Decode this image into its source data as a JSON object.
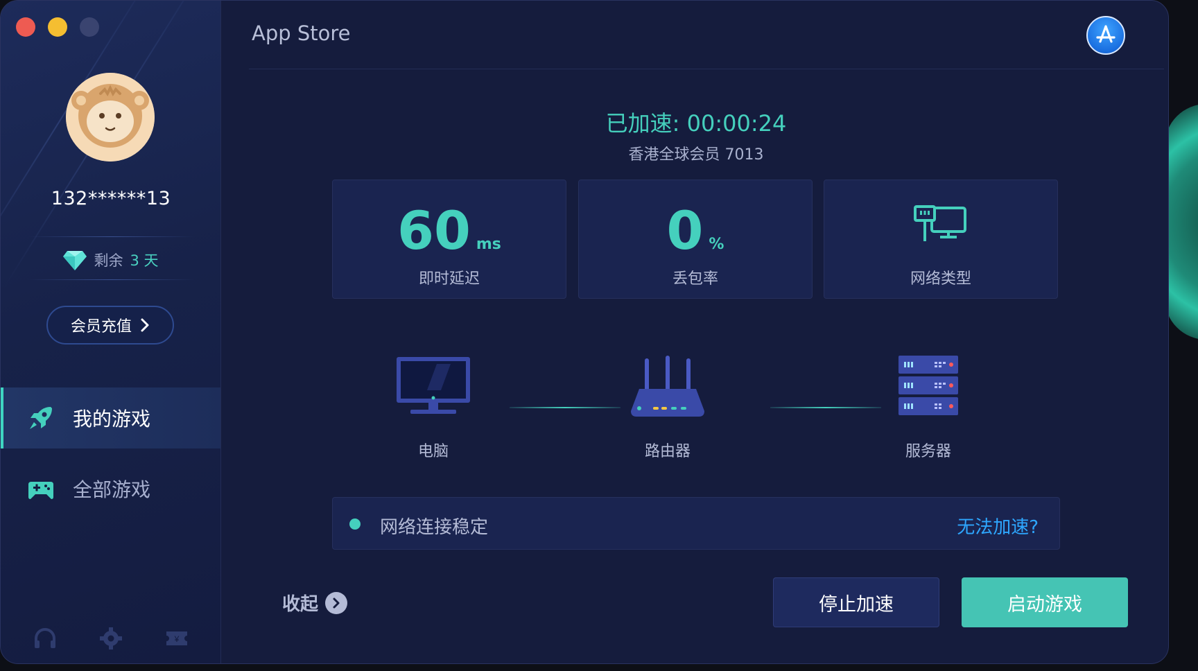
{
  "window": {
    "title": "App Store",
    "app_icon": "app-store-icon"
  },
  "sidebar": {
    "username": "132******13",
    "membership": {
      "remaining_label": "剩余",
      "remaining_value": "3 天",
      "icon": "diamond-icon"
    },
    "recharge_label": "会员充值",
    "nav": [
      {
        "label": "我的游戏",
        "icon": "rocket-icon",
        "active": true
      },
      {
        "label": "全部游戏",
        "icon": "gamepad-icon",
        "active": false
      }
    ],
    "bottom_icons": [
      "headset-icon",
      "gear-icon",
      "ticket-icon"
    ]
  },
  "main": {
    "accelerated_text": "已加速: 00:00:24",
    "node_name": "香港全球会员 7013",
    "stats": [
      {
        "value": "60",
        "unit": "ms",
        "label": "即时延迟"
      },
      {
        "value": "0",
        "unit": "%",
        "label": "丢包率"
      },
      {
        "value": "",
        "unit": "",
        "label": "网络类型",
        "icon": "wired-network-icon"
      }
    ],
    "devices": [
      {
        "label": "电脑",
        "icon": "computer-icon"
      },
      {
        "label": "路由器",
        "icon": "router-icon"
      },
      {
        "label": "服务器",
        "icon": "server-icon"
      }
    ],
    "status_text": "网络连接稳定",
    "help_link": "无法加速?",
    "collapse_label": "收起",
    "stop_button": "停止加速",
    "start_button": "启动游戏"
  },
  "colors": {
    "accent": "#45d0bd",
    "link": "#2ea7ff",
    "window_bg": "#151c3d",
    "card_bg": "#1a2450"
  }
}
